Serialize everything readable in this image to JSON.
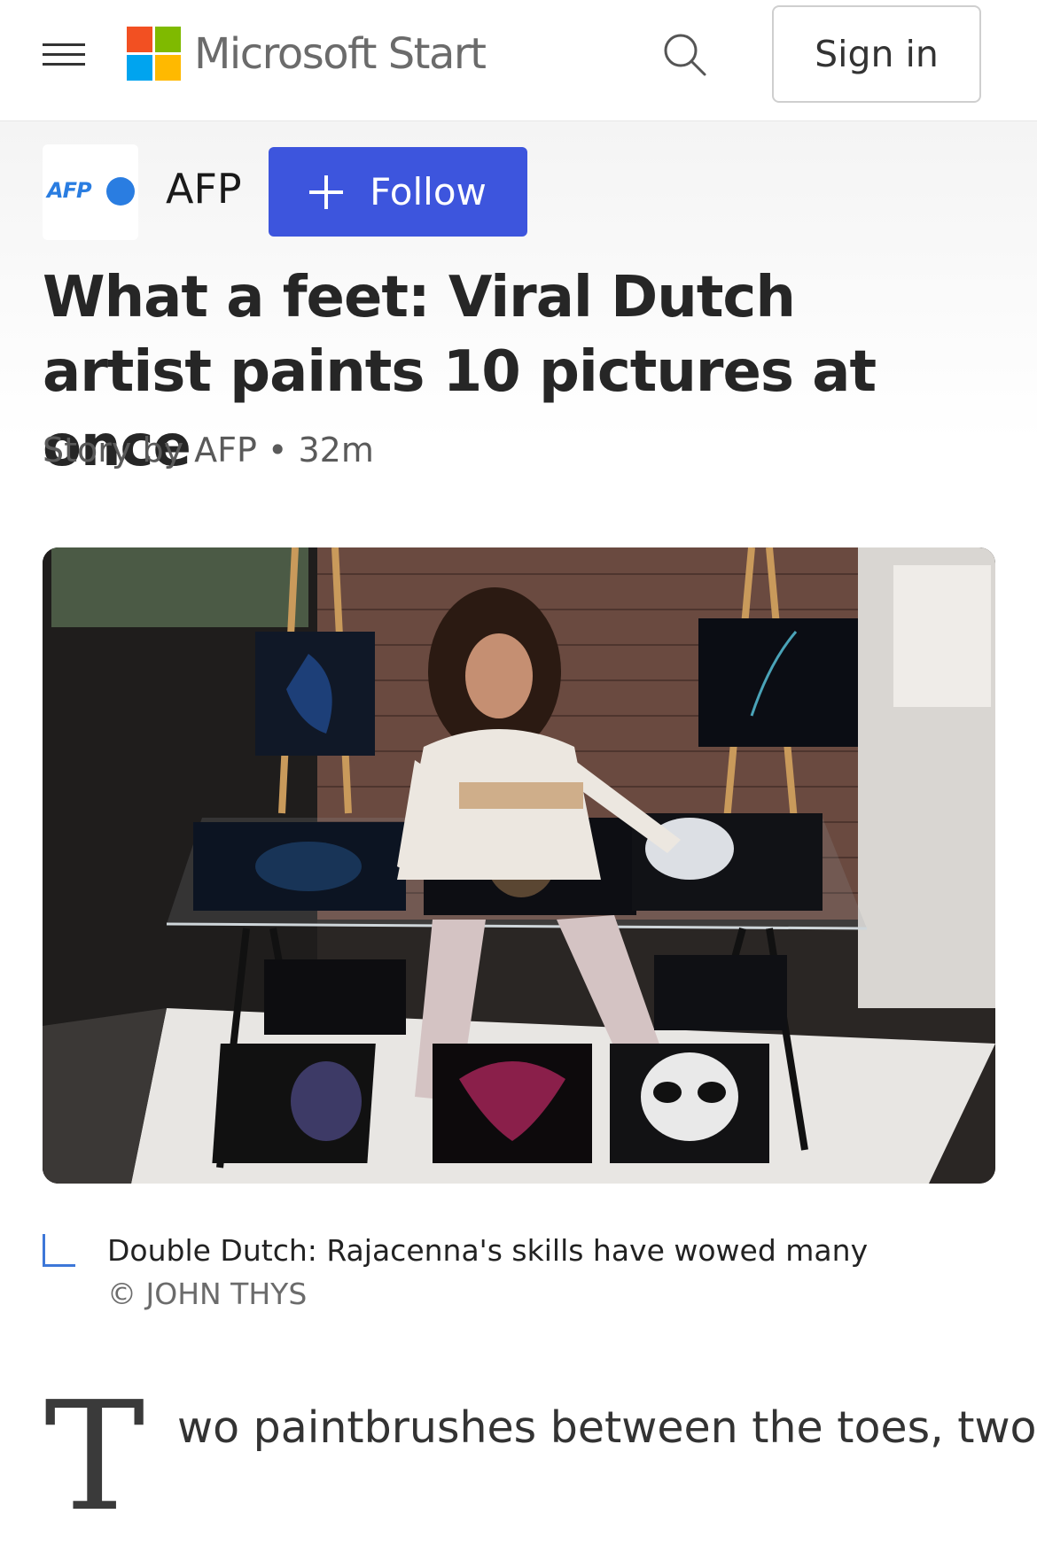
{
  "topbar": {
    "brand": "Microsoft Start",
    "signin_label": "Sign in",
    "icons": [
      "menu-icon",
      "microsoft-logo",
      "search-icon"
    ]
  },
  "publisher": {
    "logo_text": "AFP",
    "name": "AFP",
    "follow_label": "Follow"
  },
  "article": {
    "headline": "What a feet: Viral Dutch artist paints 10 pictures at once",
    "byline": "Story by AFP • 32m",
    "caption": "Double Dutch: Rajacenna's skills have wowed many",
    "credit": "© JOHN THYS",
    "dropcap": "T",
    "first_line": "wo paintbrushes between the toes, two"
  },
  "colors": {
    "follow_button": "#3d55dd",
    "caption_accent": "#3d77d8",
    "ms_red": "#f25022",
    "ms_green": "#7fba00",
    "ms_blue": "#00a4ef",
    "ms_yellow": "#ffb900"
  }
}
